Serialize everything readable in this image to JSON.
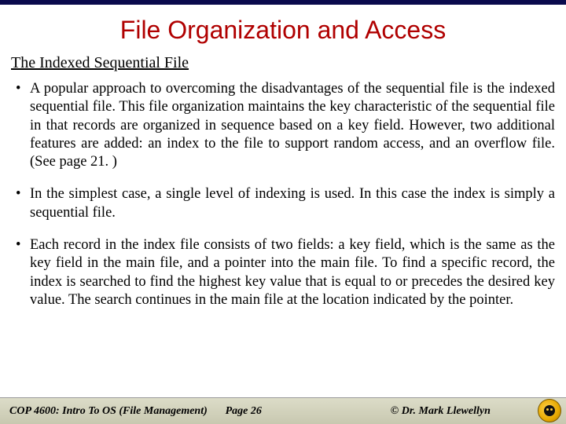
{
  "title": "File Organization and Access",
  "subtitle": "The Indexed Sequential File",
  "bullets": [
    "A popular approach to overcoming the disadvantages of the sequential file is the indexed sequential file.  This file organization maintains the key characteristic of the sequential file in that records are organized in sequence based on a key field.  However, two additional features are added: an index to the file to support random access, and an overflow file. (See page 21. )",
    "In  the simplest case, a single level of indexing is used.  In this case the index is simply a sequential file.",
    "Each record in the index file consists of two fields: a key field, which is the same as the key field in the main file, and a pointer into the main file. To find a specific record, the index is searched to find the highest key value that is equal to or precedes the desired key value.  The search continues in the main file at the location indicated by the pointer."
  ],
  "footer": {
    "course": "COP 4600: Intro To OS  (File Management)",
    "page": "Page 26",
    "author": "© Dr. Mark Llewellyn"
  }
}
